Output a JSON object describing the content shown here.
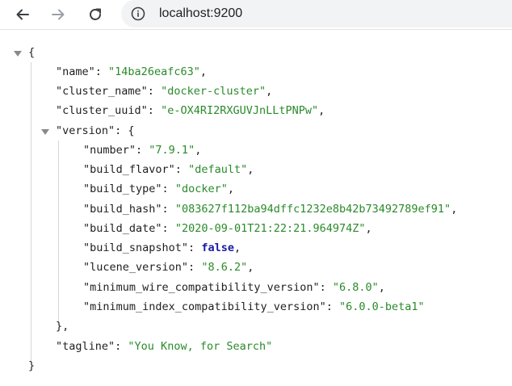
{
  "browser": {
    "url": "localhost:9200",
    "back_icon": "arrow-left-icon",
    "forward_icon": "arrow-right-icon",
    "reload_icon": "reload-icon",
    "site_info_icon": "info-circle-icon"
  },
  "json": {
    "open_brace": "{",
    "close_brace": "}",
    "version_close": "},",
    "name": {
      "key": "\"name\"",
      "value": "\"14ba26eafc63\""
    },
    "cluster_name": {
      "key": "\"cluster_name\"",
      "value": "\"docker-cluster\""
    },
    "cluster_uuid": {
      "key": "\"cluster_uuid\"",
      "value": "\"e-OX4RI2RXGUVJnLLtPNPw\""
    },
    "version_key": "\"version\"",
    "version": {
      "number": {
        "key": "\"number\"",
        "value": "\"7.9.1\""
      },
      "build_flavor": {
        "key": "\"build_flavor\"",
        "value": "\"default\""
      },
      "build_type": {
        "key": "\"build_type\"",
        "value": "\"docker\""
      },
      "build_hash": {
        "key": "\"build_hash\"",
        "value": "\"083627f112ba94dffc1232e8b42b73492789ef91\""
      },
      "build_date": {
        "key": "\"build_date\"",
        "value": "\"2020-09-01T21:22:21.964974Z\""
      },
      "build_snapshot": {
        "key": "\"build_snapshot\"",
        "value": "false"
      },
      "lucene_version": {
        "key": "\"lucene_version\"",
        "value": "\"8.6.2\""
      },
      "minimum_wire_compatibility_version": {
        "key": "\"minimum_wire_compatibility_version\"",
        "value": "\"6.8.0\""
      },
      "minimum_index_compatibility_version": {
        "key": "\"minimum_index_compatibility_version\"",
        "value": "\"6.0.0-beta1\""
      }
    },
    "tagline": {
      "key": "\"tagline\"",
      "value": "\"You Know, for Search\""
    }
  },
  "colors": {
    "string": "#2a8a2a",
    "boolean": "#1a1aa6",
    "key": "#1f1f1f"
  }
}
